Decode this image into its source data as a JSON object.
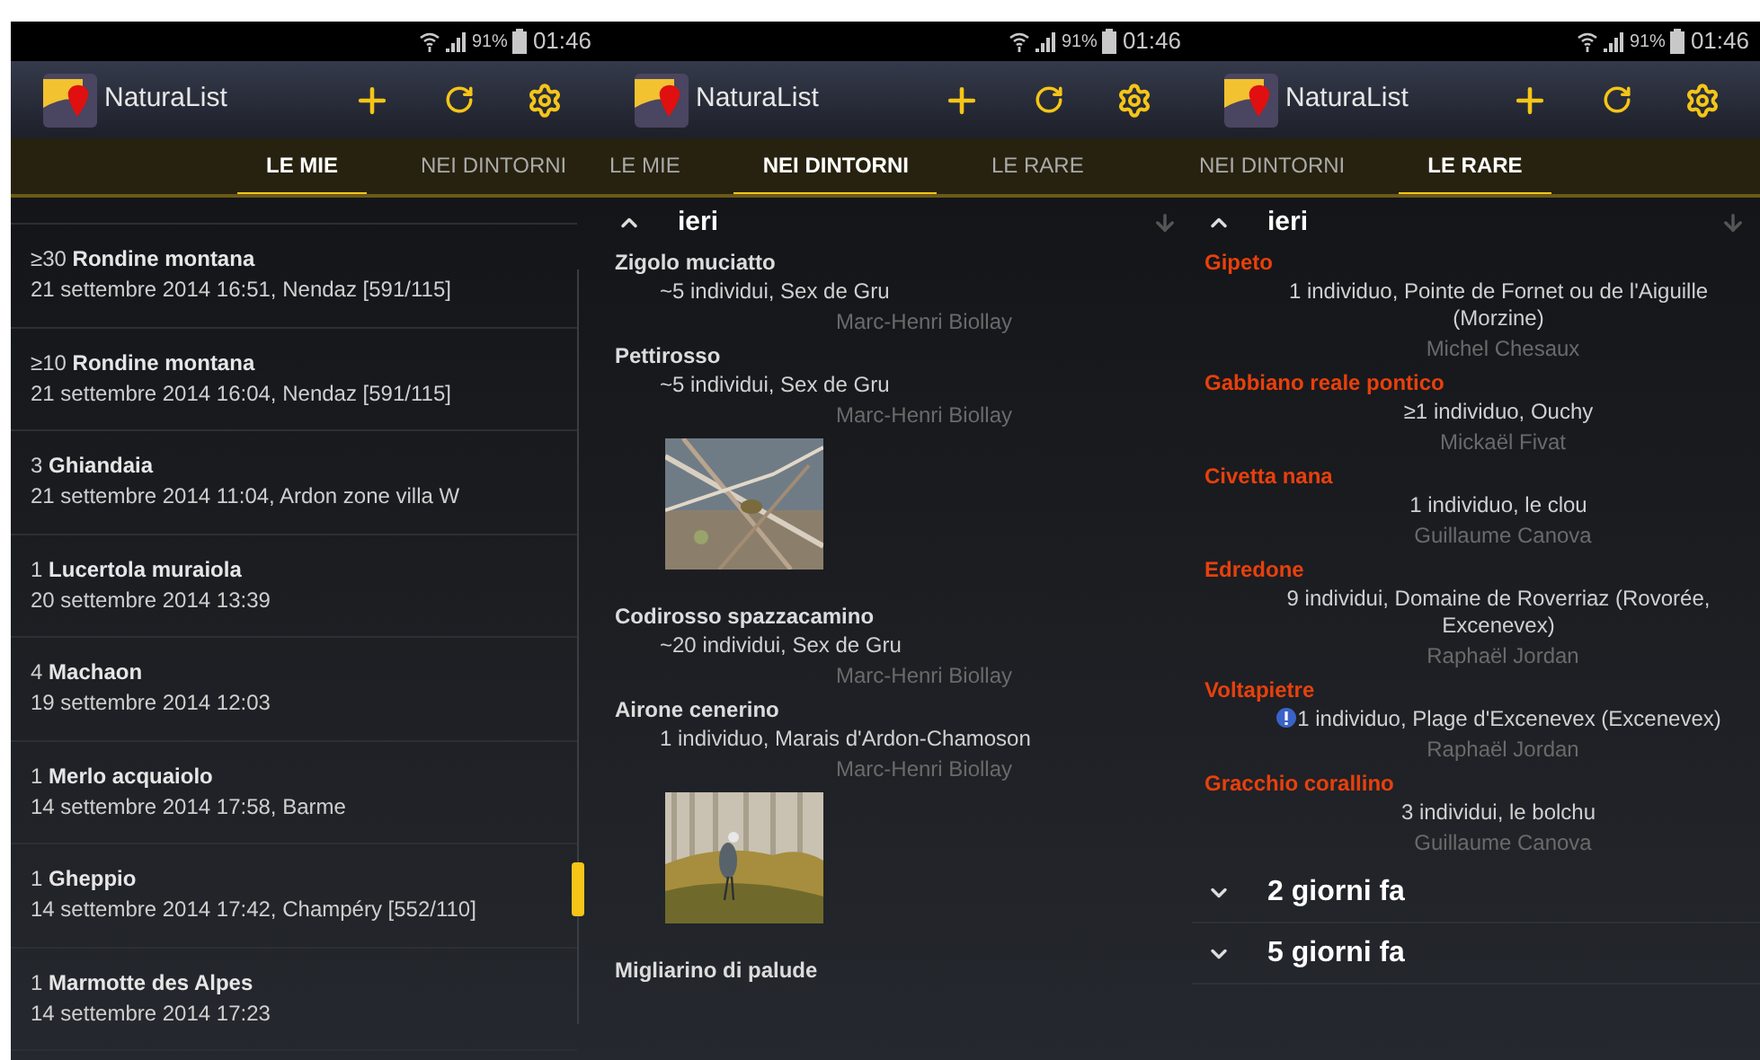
{
  "panels": [
    {
      "status": {
        "battery": "91%",
        "time": "01:46"
      },
      "app_title": "NaturaList",
      "tabs": [
        {
          "label": "LE MIE",
          "selected": true
        },
        {
          "label": "NEI DINTORNI",
          "selected": false
        }
      ],
      "kind": "list",
      "observations": [
        {
          "count": "≥30",
          "name": "Rondine montana",
          "detail": "21 settembre 2014 16:51, Nendaz [591/115]"
        },
        {
          "count": "≥10",
          "name": "Rondine montana",
          "detail": "21 settembre 2014 16:04, Nendaz [591/115]"
        },
        {
          "count": "3",
          "name": "Ghiandaia",
          "detail": "21 settembre 2014 11:04, Ardon zone villa W"
        },
        {
          "count": "1",
          "name": "Lucertola muraiola",
          "detail": "20 settembre 2014 13:39"
        },
        {
          "count": "4",
          "name": "Machaon",
          "detail": "19 settembre 2014 12:03"
        },
        {
          "count": "1",
          "name": "Merlo acquaiolo",
          "detail": "14 settembre 2014 17:58, Barme"
        },
        {
          "count": "1",
          "name": "Gheppio",
          "detail": "14 settembre 2014 17:42, Champéry [552/110]"
        },
        {
          "count": "1",
          "name": "Marmotte des Alpes",
          "detail": "14 settembre 2014 17:23"
        }
      ]
    },
    {
      "status": {
        "battery": "91%",
        "time": "01:46"
      },
      "app_title": "NaturaList",
      "tabs": [
        {
          "label": "LE MIE",
          "selected": false
        },
        {
          "label": "NEI DINTORNI",
          "selected": true
        },
        {
          "label": "LE RARE",
          "selected": false
        }
      ],
      "kind": "groups",
      "groups": [
        {
          "label": "ieri",
          "expanded": true,
          "items": [
            {
              "name": "Zigolo muciatto",
              "detail": "~5 individui, Sex de Gru",
              "observer": "Marc-Henri Biollay"
            },
            {
              "name": "Pettirosso",
              "detail": "~5 individui, Sex de Gru",
              "observer": "Marc-Henri Biollay"
            },
            {
              "name": "Codirosso spazzacamino",
              "detail": "~20 individui, Sex de Gru",
              "observer": "Marc-Henri Biollay"
            },
            {
              "name": "Airone cenerino",
              "detail": "1 individuo, Marais d'Ardon-Chamoson",
              "observer": "Marc-Henri Biollay"
            },
            {
              "name": "Migliarino di palude"
            }
          ]
        }
      ]
    },
    {
      "status": {
        "battery": "91%",
        "time": "01:46"
      },
      "app_title": "NaturaList",
      "tabs": [
        {
          "label": "NEI DINTORNI",
          "selected": false
        },
        {
          "label": "LE RARE",
          "selected": true
        }
      ],
      "kind": "groups",
      "groups": [
        {
          "label": "ieri",
          "expanded": true,
          "items": [
            {
              "name": "Gipeto",
              "detail": "1 individuo, Pointe de Fornet ou de l'Aiguille (Morzine)",
              "observer": "Michel Chesaux",
              "rare": true,
              "flagged": false
            },
            {
              "name": "Gabbiano reale pontico",
              "detail": "≥1 individuo, Ouchy",
              "observer": "Mickaël Fivat",
              "rare": true,
              "flagged": false
            },
            {
              "name": "Civetta nana",
              "detail": "1 individuo, le clou",
              "observer": "Guillaume Canova",
              "rare": true,
              "flagged": false
            },
            {
              "name": "Edredone",
              "detail": "9 individui, Domaine de Roverriaz (Rovorée, Excenevex)",
              "observer": "Raphaël Jordan",
              "rare": true,
              "flagged": false
            },
            {
              "name": "Voltapietre",
              "detail": "1 individuo, Plage d'Excenevex (Excenevex)",
              "observer": "Raphaël Jordan",
              "rare": true,
              "flagged": true
            },
            {
              "name": "Gracchio corallino",
              "detail": "3 individui, le bolchu",
              "observer": "Guillaume Canova",
              "rare": true,
              "flagged": false
            }
          ]
        },
        {
          "label": "2 giorni fa",
          "expanded": false
        },
        {
          "label": "5 giorni fa",
          "expanded": false
        }
      ]
    }
  ]
}
